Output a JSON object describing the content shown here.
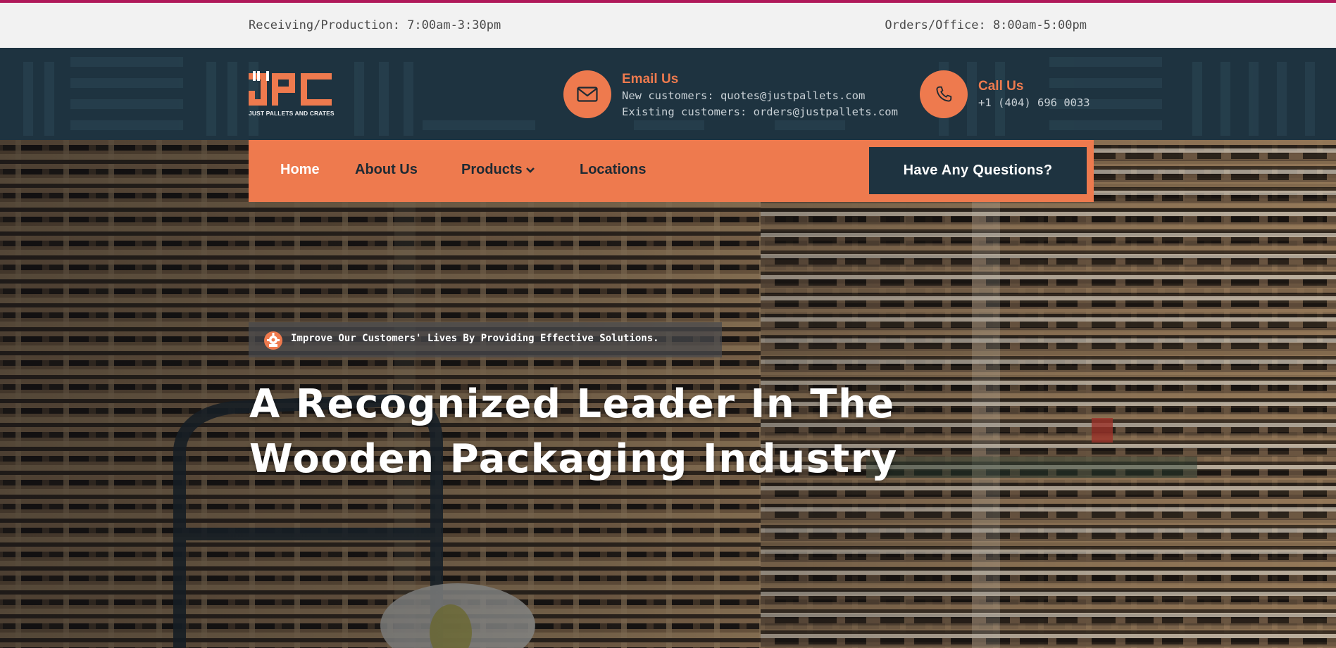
{
  "hours": {
    "receiving": "Receiving/Production: 7:00am-3:30pm",
    "office": "Orders/Office: 8:00am-5:00pm"
  },
  "logo": {
    "letters": "JPC",
    "tagline": "JUST PALLETS AND CRATES"
  },
  "contacts": {
    "email": {
      "icon": "envelope-icon",
      "title": "Email Us",
      "line1": "New customers: quotes@justpallets.com",
      "line2": "Existing customers: orders@justpallets.com"
    },
    "call": {
      "icon": "phone-icon",
      "title": "Call Us",
      "line1": "+1 (404) 696 0033"
    }
  },
  "nav": {
    "items": [
      {
        "label": "Home"
      },
      {
        "label": "About Us"
      },
      {
        "label": "Products"
      },
      {
        "label": "Locations"
      }
    ],
    "cta": "Have Any Questions?"
  },
  "hero": {
    "tagline": "Improve Our Customers' Lives By Providing Effective Solutions.",
    "headline_line1": "A Recognized Leader In The",
    "headline_line2": "Wooden Packaging Industry"
  },
  "colors": {
    "accent": "#ee7a4e",
    "navy": "#1e3340",
    "top_line": "#b0195a",
    "hours_bg": "#f2f2f2"
  }
}
